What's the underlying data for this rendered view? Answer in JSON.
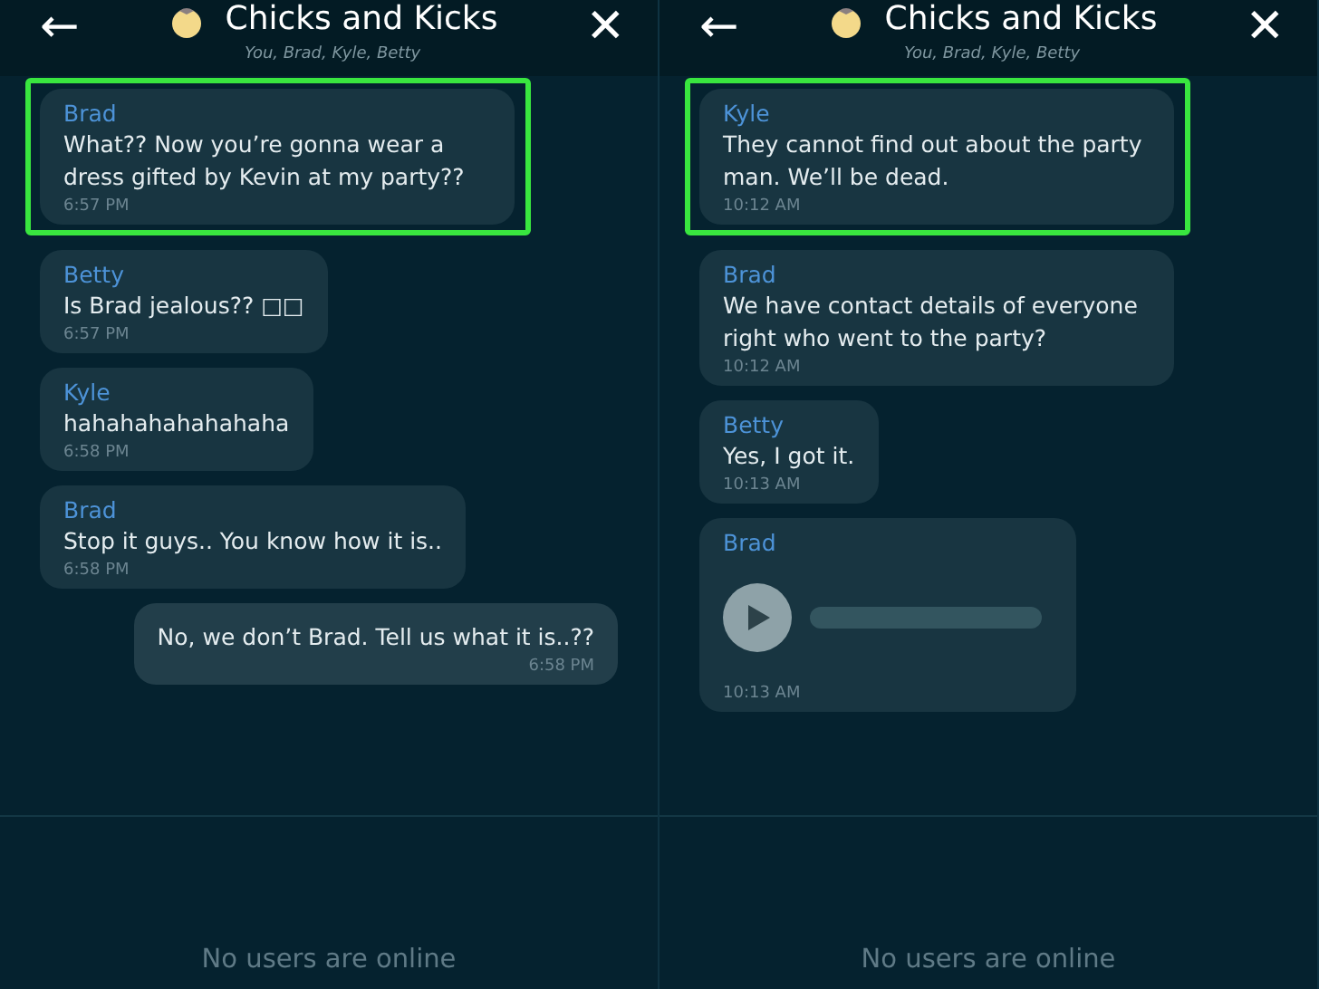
{
  "panels": [
    {
      "header": {
        "back": "←",
        "title": "Chicks and Kicks",
        "close": "✕",
        "members": "You, Brad, Kyle, Betty"
      },
      "messages": [
        {
          "kind": "incoming",
          "sender": "Brad",
          "text": "What?? Now you’re gonna wear a dress gifted by Kevin at my party??",
          "time": "6:57 PM",
          "highlighted": true
        },
        {
          "kind": "incoming",
          "sender": "Betty",
          "text": "Is Brad jealous?? □□",
          "time": "6:57 PM",
          "highlighted": false
        },
        {
          "kind": "incoming",
          "sender": "Kyle",
          "text": "hahahahahahahaha",
          "time": "6:58 PM",
          "highlighted": false
        },
        {
          "kind": "incoming",
          "sender": "Brad",
          "text": "Stop it guys.. You know how it is..",
          "time": "6:58 PM",
          "highlighted": false
        },
        {
          "kind": "outgoing",
          "text": "No, we don’t Brad. Tell us what it is..??",
          "time": "6:58 PM",
          "highlighted": false
        }
      ],
      "status": "No users are online"
    },
    {
      "header": {
        "back": "←",
        "title": "Chicks and Kicks",
        "close": "✕",
        "members": "You, Brad, Kyle, Betty"
      },
      "messages": [
        {
          "kind": "incoming",
          "sender": "Kyle",
          "text": "They cannot find out about the party man. We’ll be dead.",
          "time": "10:12 AM",
          "highlighted": true
        },
        {
          "kind": "incoming",
          "sender": "Brad",
          "text": "We have contact details of everyone right who went to the party?",
          "time": "10:12 AM",
          "highlighted": false
        },
        {
          "kind": "incoming",
          "sender": "Betty",
          "text": "Yes, I got it.",
          "time": "10:13 AM",
          "highlighted": false
        },
        {
          "kind": "audio",
          "sender": "Brad",
          "time": "10:13 AM",
          "highlighted": false
        }
      ],
      "status": "No users are online"
    }
  ]
}
